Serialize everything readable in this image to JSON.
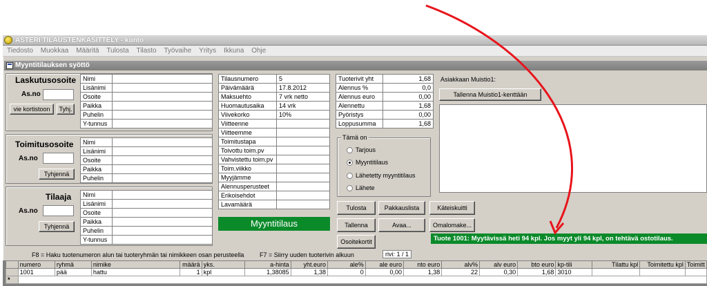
{
  "window_title": "ASTERI TILAUSTENKÄSITTELY - kunto",
  "menu": [
    "Tiedosto",
    "Muokkaa",
    "Määritä",
    "Tulosta",
    "Tilasto",
    "Työvaihe",
    "Yritys",
    "Ikkuna",
    "Ohje"
  ],
  "child_title": "Myyntitilauksen syöttö",
  "billing": {
    "title": "Laskutusosoite",
    "asno_label": "As.no",
    "btn_card": "vie kortistoon",
    "btn_clear": "Tyhj.",
    "fields": [
      "Nimi",
      "Lisänimi",
      "Osoite",
      "Paikka",
      "Puhelin",
      "Y-tunnus"
    ]
  },
  "delivery": {
    "title": "Toimitusosoite",
    "asno_label": "As.no",
    "btn_clear": "Tyhjennä",
    "fields": [
      "Nimi",
      "Lisänimi",
      "Osoite",
      "Paikka",
      "Puhelin"
    ]
  },
  "orderer": {
    "title": "Tilaaja",
    "asno_label": "As.no",
    "btn_clear": "Tyhjennä",
    "fields": [
      "Nimi",
      "Lisänimi",
      "Osoite",
      "Paikka",
      "Puhelin",
      "Y-tunnus"
    ]
  },
  "order_info": [
    {
      "label": "Tilausnumero",
      "value": "5"
    },
    {
      "label": "Päivämäärä",
      "value": "17.8.2012"
    },
    {
      "label": "Maksuehto",
      "value": "7 vrk netto"
    },
    {
      "label": "Huomautusaika",
      "value": "14 vrk"
    },
    {
      "label": "Viivekorko",
      "value": "10%"
    },
    {
      "label": "Viitteenne",
      "value": ""
    },
    {
      "label": "Viitteemme",
      "value": ""
    },
    {
      "label": "Toimitustapa",
      "value": ""
    },
    {
      "label": "Toivottu toim.pv",
      "value": ""
    },
    {
      "label": "Vahvistettu toim.pv",
      "value": ""
    },
    {
      "label": "Toim.viikko",
      "value": ""
    },
    {
      "label": "Myyjämme",
      "value": ""
    },
    {
      "label": "Alennusperusteet",
      "value": ""
    },
    {
      "label": "Erikoisehdot",
      "value": ""
    },
    {
      "label": "Lavamäärä",
      "value": ""
    }
  ],
  "totals": [
    {
      "label": "Tuoterivit yht",
      "value": "1,68"
    },
    {
      "label": "Alennus %",
      "value": "0,0"
    },
    {
      "label": "Alennus euro",
      "value": "0,00"
    },
    {
      "label": "Alennettu",
      "value": "1,68"
    },
    {
      "label": "Pyöristys",
      "value": "0,00"
    },
    {
      "label": "Loppusumma",
      "value": "1,68"
    }
  ],
  "doc_type": {
    "title": "Tämä on",
    "options": [
      "Tarjous",
      "Myyntitilaus",
      "Lähetetty myyntitilaus",
      "Lähete"
    ],
    "selected": "Myyntitilaus"
  },
  "memo": {
    "label": "Asiakkaan Muistio1:",
    "save_button": "Tallenna Muistio1-kenttään"
  },
  "status_label": "Myyntitilaus",
  "buttons": {
    "tulosta": "Tulosta",
    "pakkauslista": "Pakkauslista",
    "kateiskuitti": "Käteiskuitti",
    "tallenna": "Tallenna",
    "avaa": "Avaa...",
    "omalomake": "Omalomake...",
    "osoitekortit": "Osoitekortit"
  },
  "message": "Tuote 1001: Myytävissä heti 94 kpl. Jos myyt yli 94 kpl, on tehtävä ostotilaus.",
  "hints": {
    "f8": "F8 = Haku tuotenumeron alun tai tuoteryhmän tai nimikkeen osan perusteella",
    "f7": "F7 = Siirry uuden tuoterivin alkuun",
    "row_counter": "rivi: 1 / 1"
  },
  "grid": {
    "columns": [
      "numero",
      "ryhmä",
      "nimike",
      "määrä",
      "yks.",
      "a-hinta",
      "yht.euro",
      "ale%",
      "ale euro",
      "nto euro",
      "alv%",
      "alv euro",
      "bto euro",
      "kp-tili",
      "Tilattu kpl",
      "Toimitettu kpl",
      "Toimitt"
    ],
    "rows": [
      [
        "1001",
        "pää",
        "hattu",
        "1",
        "kpl",
        "1,38085",
        "1,38",
        "0",
        "0,00",
        "1,38",
        "22",
        "0,30",
        "1,68",
        "3010",
        "",
        "",
        ""
      ]
    ],
    "new_row_marker": "*"
  },
  "colors": {
    "status_green": "#0b8a2a",
    "arrow_red": "#e8141c",
    "panel_gray": "#d4d0c8"
  }
}
